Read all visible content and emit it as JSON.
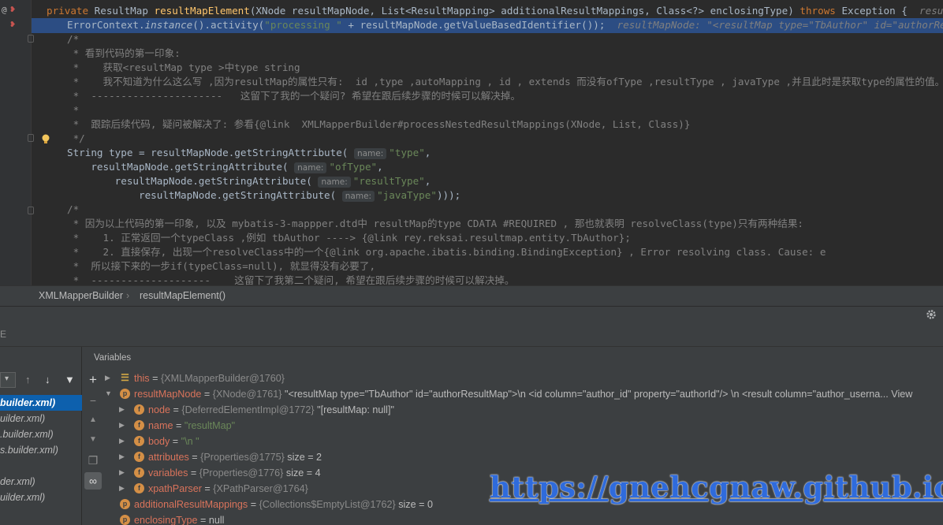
{
  "editor": {
    "lines": [
      {
        "parts": [
          [
            "kw",
            "private "
          ],
          [
            "",
            "ResultMap "
          ],
          [
            "fn",
            "resultMapElement"
          ],
          [
            "",
            "(XNode resultMapNode, List<ResultMapping> additionalResultMappings, Class<?> enclosingType) "
          ],
          [
            "kw",
            "throws "
          ],
          [
            "",
            "Exception {  "
          ],
          [
            "hint",
            "resultMapNode: \""
          ]
        ]
      },
      {
        "parts": [
          [
            "",
            "ErrorContext."
          ],
          [
            "it",
            "instance"
          ],
          [
            "",
            "().activity("
          ],
          [
            "str",
            "\"processing \""
          ],
          [
            "",
            " + resultMapNode.getValueBasedIdentifier());  "
          ],
          [
            "hint",
            "resultMapNode: \"<resultMap type=\"TbAuthor\" id=\"authorResultMap\">\\n"
          ]
        ]
      },
      {
        "parts": [
          [
            "cm",
            "/*"
          ]
        ]
      },
      {
        "parts": [
          [
            "cm",
            " * 看到代码的第一印象:"
          ]
        ]
      },
      {
        "parts": [
          [
            "cm",
            " *    获取<resultMap type >中type string"
          ]
        ]
      },
      {
        "parts": [
          [
            "cm",
            " *    我不知道为什么这么写 ,因为resultMap的属性只有:  id ,type ,autoMapping , id , extends 而没有ofType ,resultType , javaType ,并且此时是获取type的属性的值。"
          ]
        ]
      },
      {
        "parts": [
          [
            "cm",
            " *  ----------------------   这留下了我的一个疑问? 希望在跟后续步骤的时候可以解决掉。"
          ]
        ]
      },
      {
        "parts": [
          [
            "cm",
            " *"
          ]
        ]
      },
      {
        "parts": [
          [
            "cm",
            " *  跟踪后续代码, 疑问被解决了: 参看{@link  XMLMapperBuilder#processNestedResultMappings(XNode, List, Class)}"
          ]
        ]
      },
      {
        "parts": [
          [
            "cm",
            " */"
          ]
        ]
      },
      {
        "parts": [
          [
            "",
            "String type = resultMapNode.getStringAttribute( "
          ],
          [
            "inl",
            "name:"
          ],
          [
            "str",
            "\"type\""
          ],
          [
            "",
            ","
          ]
        ]
      },
      {
        "parts": [
          [
            "",
            "    resultMapNode.getStringAttribute( "
          ],
          [
            "inl",
            "name:"
          ],
          [
            "str",
            "\"ofType\""
          ],
          [
            "",
            ","
          ]
        ]
      },
      {
        "parts": [
          [
            "",
            "        resultMapNode.getStringAttribute( "
          ],
          [
            "inl",
            "name:"
          ],
          [
            "str",
            "\"resultType\""
          ],
          [
            "",
            ","
          ]
        ]
      },
      {
        "parts": [
          [
            "",
            "            resultMapNode.getStringAttribute( "
          ],
          [
            "inl",
            "name:"
          ],
          [
            "str",
            "\"javaType\""
          ],
          [
            "",
            ")));"
          ]
        ]
      },
      {
        "parts": [
          [
            "cm",
            "/*"
          ]
        ]
      },
      {
        "parts": [
          [
            "cm",
            " * 因为以上代码的第一印象, 以及 mybatis-3-mappper.dtd中 resultMap的type CDATA #REQUIRED , 那也就表明 resolveClass(type)只有两种结果:"
          ]
        ]
      },
      {
        "parts": [
          [
            "cm",
            " *    1. 正常返回一个typeClass ,例如 tbAuthor ----> {@link rey.reksai.resultmap.entity.TbAuthor};"
          ]
        ]
      },
      {
        "parts": [
          [
            "cm",
            " *    2. 直接保存, 出现一个resolveClass中的一个{@link org.apache.ibatis.binding.BindingException} , Error resolving class. Cause: e"
          ]
        ]
      },
      {
        "parts": [
          [
            "cm",
            " *  所以接下来的一步if(typeClass=null), 就显得没有必要了,"
          ]
        ]
      },
      {
        "parts": [
          [
            "cm",
            " *  --------------------    这留下了我第二个疑问, 希望在跟后续步骤的时候可以解决掉。"
          ]
        ]
      }
    ]
  },
  "breadcrumb": {
    "items": [
      "XMLMapperBuilder",
      "resultMapElement()"
    ]
  },
  "debugger": {
    "panel_label": "E",
    "variables_title": "Variables",
    "frames": [
      {
        "label": "builder.xml)",
        "selected": true
      },
      {
        "label": "uilder.xml)",
        "selected": false
      },
      {
        "label": ".builder.xml)",
        "selected": false
      },
      {
        "label": "s.builder.xml)",
        "selected": false
      },
      {
        "label": "der.xml)",
        "selected": false
      },
      {
        "label": "uilder.xml)",
        "selected": false
      }
    ],
    "variables": [
      {
        "indent": 0,
        "expanded": false,
        "icon": "list-icon",
        "name": "this",
        "type": "{XMLMapperBuilder@1760}",
        "value": ""
      },
      {
        "indent": 0,
        "expanded": true,
        "icon": "p",
        "name": "resultMapNode",
        "type": "{XNode@1761}",
        "value": "\"<resultMap type=\"TbAuthor\" id=\"authorResultMap\">\\n    <id column=\"author_id\" property=\"authorId\"/>   \\n    <result column=\"author_userna... View"
      },
      {
        "indent": 1,
        "expanded": false,
        "icon": "f",
        "name": "node",
        "type": "{DeferredElementImpl@1772}",
        "value": "\"[resultMap: null]\""
      },
      {
        "indent": 1,
        "expanded": false,
        "icon": "f",
        "name": "name",
        "type": "",
        "value": "\"resultMap\"",
        "isString": true
      },
      {
        "indent": 1,
        "expanded": false,
        "icon": "f",
        "name": "body",
        "type": "",
        "value": "\"\\n    \"",
        "isString": true
      },
      {
        "indent": 1,
        "expanded": false,
        "icon": "f",
        "name": "attributes",
        "type": "{Properties@1775}",
        "value": "size = 2"
      },
      {
        "indent": 1,
        "expanded": false,
        "icon": "f",
        "name": "variables",
        "type": "{Properties@1776}",
        "value": "size = 4"
      },
      {
        "indent": 1,
        "expanded": false,
        "icon": "f",
        "name": "xpathParser",
        "type": "{XPathParser@1764}",
        "value": ""
      },
      {
        "indent": 0,
        "expanded": null,
        "icon": "p",
        "name": "additionalResultMappings",
        "type": "{Collections$EmptyList@1762}",
        "value": "size = 0"
      },
      {
        "indent": 0,
        "expanded": null,
        "icon": "p",
        "name": "enclosingType",
        "type": "",
        "value": "null"
      }
    ]
  },
  "watermark": "https://gnehcgnaw.github.io/"
}
